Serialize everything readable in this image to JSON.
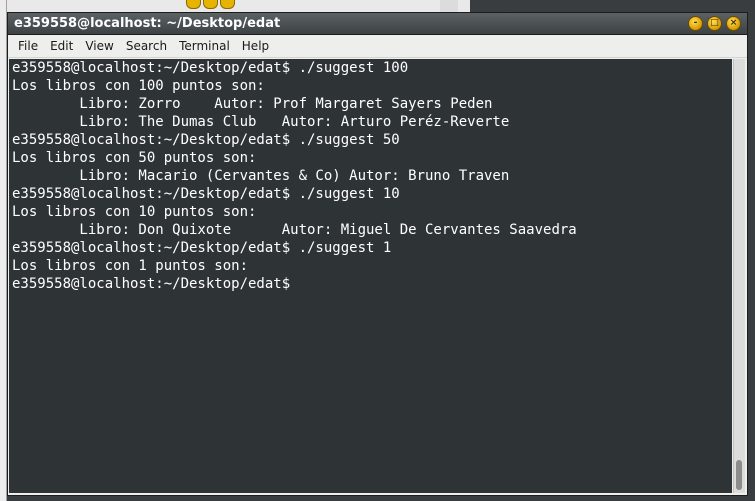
{
  "window": {
    "title": "e359558@localhost: ~/Desktop/edat",
    "controls": {
      "minimize_glyph": "‐",
      "maximize_glyph": "□",
      "close_glyph": "×"
    }
  },
  "menubar": {
    "items": [
      "File",
      "Edit",
      "View",
      "Search",
      "Terminal",
      "Help"
    ]
  },
  "terminal": {
    "lines": [
      "e359558@localhost:~/Desktop/edat$ ./suggest 100",
      "Los libros con 100 puntos son:",
      "        Libro: Zorro    Autor: Prof Margaret Sayers Peden",
      "        Libro: The Dumas Club   Autor: Arturo Peréz-Reverte",
      "e359558@localhost:~/Desktop/edat$ ./suggest 50",
      "Los libros con 50 puntos son:",
      "        Libro: Macario (Cervantes & Co) Autor: Bruno Traven",
      "e359558@localhost:~/Desktop/edat$ ./suggest 10",
      "Los libros con 10 puntos son:",
      "        Libro: Don Quixote      Autor: Miguel De Cervantes Saavedra",
      "e359558@localhost:~/Desktop/edat$ ./suggest 1",
      "Los libros con 1 puntos son:",
      "e359558@localhost:~/Desktop/edat$ "
    ]
  },
  "colors": {
    "terminal_bg": "#2e3436",
    "terminal_fg": "#ffffff",
    "titlebar": "#4a4f52",
    "window_button": "#e6b400"
  }
}
